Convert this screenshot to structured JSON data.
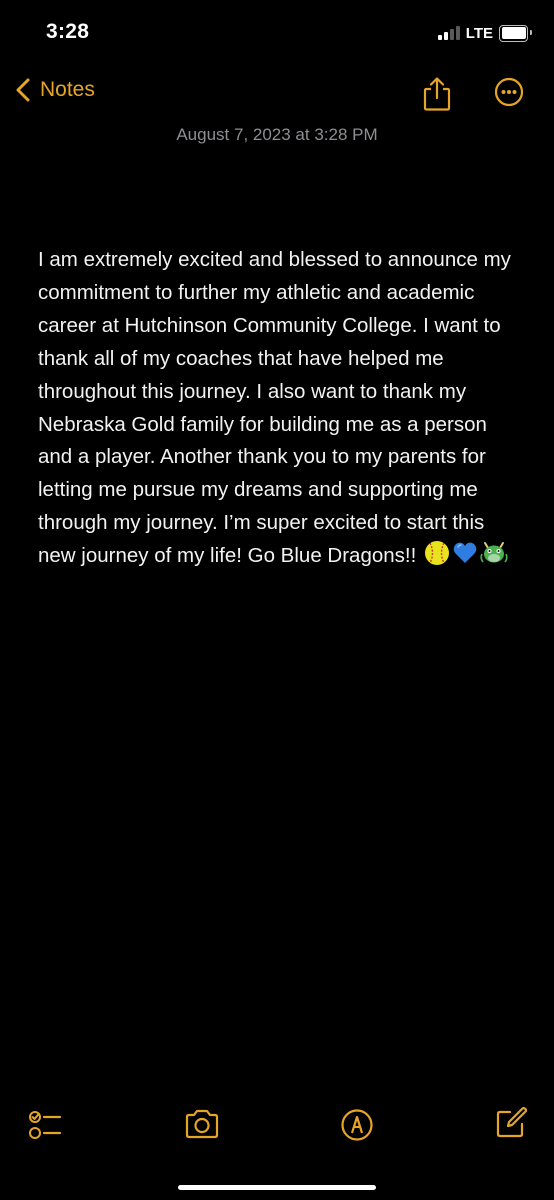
{
  "status_bar": {
    "time": "3:28",
    "network": "LTE",
    "signal_bars_filled": 2,
    "signal_bars_total": 4,
    "battery_level": 1.0
  },
  "nav": {
    "back_label": "Notes",
    "accent_color": "#e6a526"
  },
  "note": {
    "date": "August 7, 2023 at 3:28 PM",
    "body": "I am extremely excited and blessed to announce my commitment to further my athletic and academic career at Hutchinson Community College. I want to thank all of my coaches that have helped me throughout this journey. I also want to thank my Nebraska Gold family for building me as a person and a player. Another thank you to my parents for letting me pursue my dreams and supporting me through my journey. I’m super excited to start this new journey of my life! Go Blue Dragons!!",
    "emojis": [
      "softball-emoji",
      "blue-heart-emoji",
      "dragon-face-emoji"
    ]
  },
  "toolbar": {
    "icons": [
      "checklist-icon",
      "camera-icon",
      "markup-icon",
      "compose-icon"
    ]
  }
}
